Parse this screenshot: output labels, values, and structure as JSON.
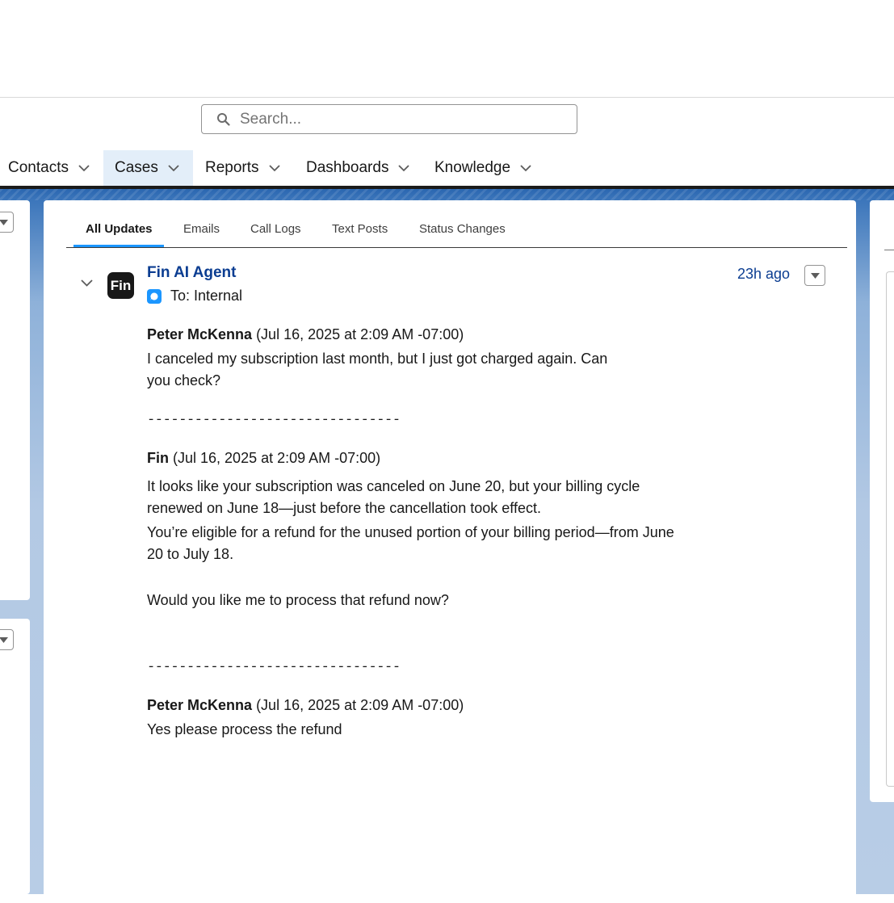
{
  "search": {
    "placeholder": "Search..."
  },
  "nav": {
    "items": [
      {
        "label": "Contacts"
      },
      {
        "label": "Cases",
        "active": true
      },
      {
        "label": "Reports"
      },
      {
        "label": "Dashboards"
      },
      {
        "label": "Knowledge"
      }
    ]
  },
  "tabs": [
    {
      "label": "All Updates",
      "active": true
    },
    {
      "label": "Emails"
    },
    {
      "label": "Call Logs"
    },
    {
      "label": "Text Posts"
    },
    {
      "label": "Status Changes"
    }
  ],
  "post": {
    "avatar_text": "Fin",
    "sender": "Fin AI Agent",
    "to": "To: Internal",
    "time": "23h ago",
    "messages": [
      {
        "author": "Peter McKenna",
        "timestamp": "(Jul 16, 2025 at 2:09 AM -07:00)",
        "lines": [
          "I canceled my subscription last month, but I just got charged again. Can",
          "you check?"
        ]
      },
      {
        "separator": "--------------------------------"
      },
      {
        "author": "Fin",
        "timestamp": "(Jul 16, 2025 at 2:09 AM -07:00)",
        "lines": [
          "It looks like your subscription was canceled on June 20, but your billing cycle",
          "renewed on June 18—just before the cancellation took effect.",
          "You’re eligible for a refund for the unused portion of your billing period—from June",
          "20 to July 18.",
          "Would you like me to process that refund now?"
        ]
      },
      {
        "separator": "--------------------------------"
      },
      {
        "author": "Peter McKenna",
        "timestamp": "(Jul 16, 2025 at 2:09 AM -07:00)",
        "lines": [
          "Yes please process the refund"
        ]
      }
    ]
  },
  "colors": {
    "accent": "#1b96ff",
    "link": "#0b3d91",
    "nav_active_bg": "#e3eef9"
  }
}
